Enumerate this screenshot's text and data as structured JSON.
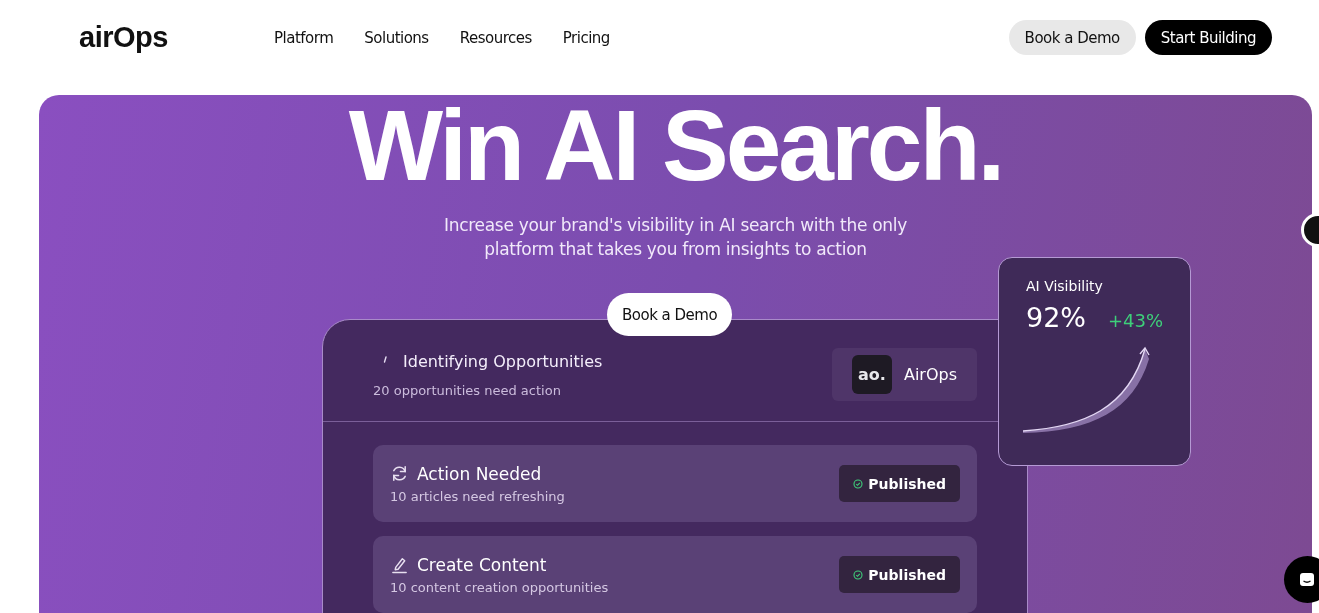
{
  "header": {
    "logo": "airOps",
    "nav": [
      "Platform",
      "Solutions",
      "Resources",
      "Pricing"
    ],
    "buttons": [
      {
        "kind": "secondary",
        "label": "Book a Demo"
      },
      {
        "kind": "primary",
        "label": "Start Building"
      }
    ]
  },
  "hero": {
    "headline": "Win AI Search.",
    "subtitle": "Increase your brand's visibility in AI search with the only platform that takes you from insights to action",
    "cta": "Book a Demo"
  },
  "panel": {
    "title": "Identifying Opportunities",
    "subtitle": "20 opportunities need action",
    "brand": {
      "logo": "ao.",
      "name": "AirOps"
    },
    "tasks": [
      {
        "kind": "refresh",
        "title": "Action Needed",
        "subtitle": "10 articles need refreshing",
        "status": "Published"
      },
      {
        "kind": "edit",
        "title": "Create Content",
        "subtitle": "10 content creation opportunities",
        "status": "Published"
      }
    ]
  },
  "metric": {
    "label": "AI Visibility",
    "value": "92%",
    "change": "+43%"
  }
}
